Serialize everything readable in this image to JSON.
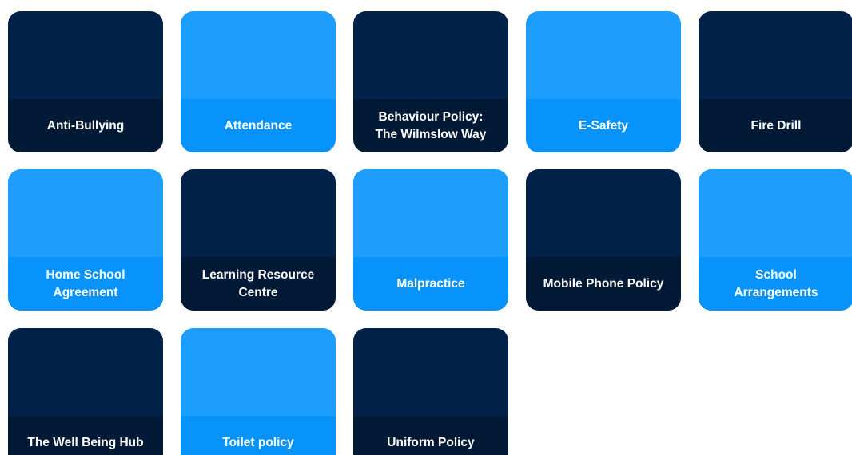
{
  "tiles": [
    {
      "label": "Anti-Bullying",
      "theme": "dark"
    },
    {
      "label": "Attendance",
      "theme": "light"
    },
    {
      "label": "Behaviour Policy:\nThe Wilmslow Way",
      "theme": "dark"
    },
    {
      "label": "E-Safety",
      "theme": "light"
    },
    {
      "label": "Fire Drill",
      "theme": "dark"
    },
    {
      "label": "Home School\nAgreement",
      "theme": "light"
    },
    {
      "label": "Learning Resource\nCentre",
      "theme": "dark"
    },
    {
      "label": "Malpractice",
      "theme": "light"
    },
    {
      "label": "Mobile Phone Policy",
      "theme": "dark"
    },
    {
      "label": "School\nArrangements",
      "theme": "light"
    },
    {
      "label": "The Well Being Hub",
      "theme": "dark"
    },
    {
      "label": "Toilet policy",
      "theme": "light"
    },
    {
      "label": "Uniform Policy",
      "theme": "dark"
    }
  ],
  "colors": {
    "dark_top": "#03224a",
    "dark_bottom": "#021a36",
    "light_top": "#1e9efc",
    "light_bottom": "#0793fa",
    "text": "#ffffff"
  }
}
